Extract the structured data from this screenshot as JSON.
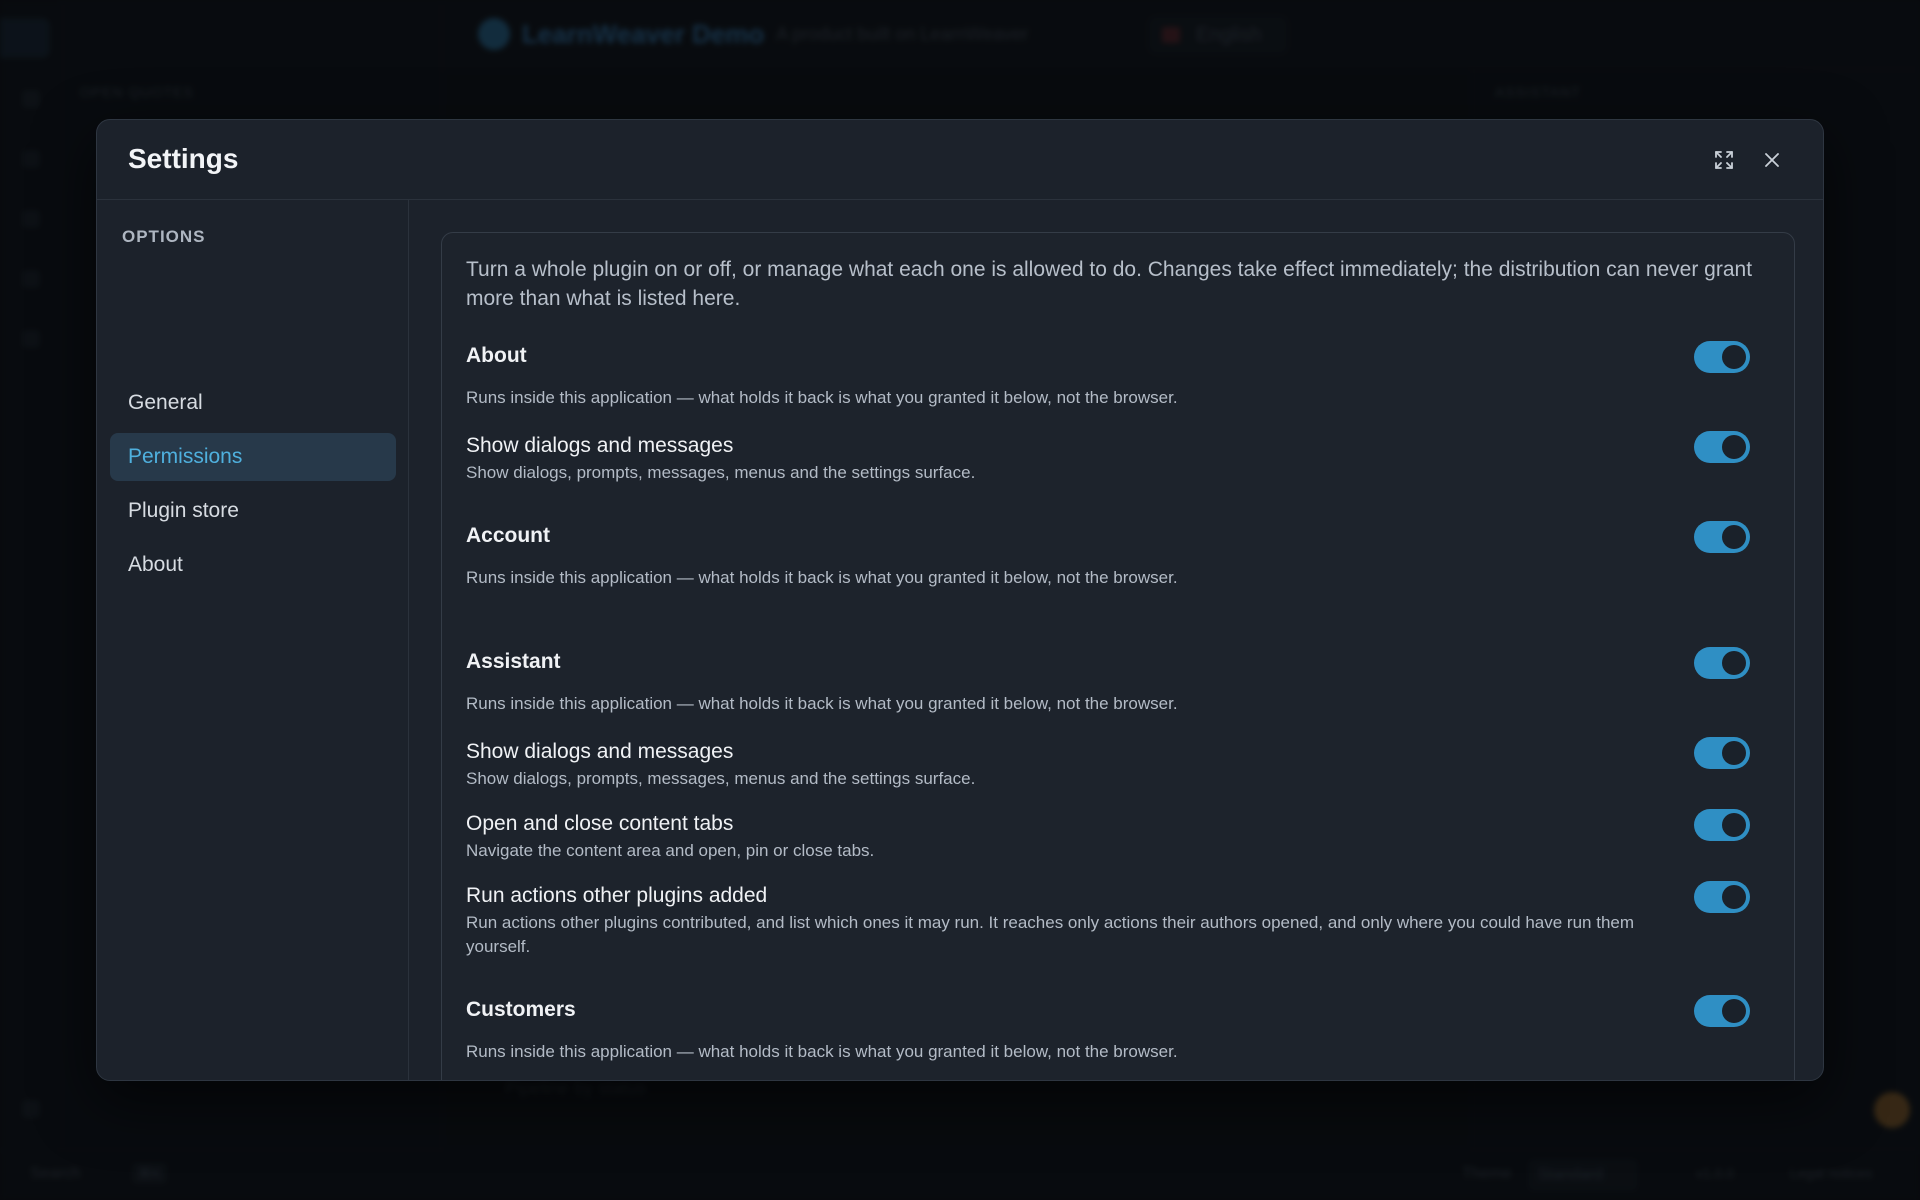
{
  "background": {
    "brand_name": "LearnWeaver Demo",
    "brand_tagline": "A product built on LearnWeaver",
    "language": "English",
    "left_section_title": "OPEN QUOTES",
    "right_section_title": "ASSISTANT",
    "pipeline_label": "Pipeline by status",
    "search_label": "Search",
    "search_shortcut": "⌘K",
    "theme_label": "Theme",
    "theme_value": "Standard",
    "version": "v1.0.0",
    "legal": "Legal notices"
  },
  "modal": {
    "title": "Settings",
    "expand_icon": "expand-icon",
    "close_icon": "close-icon"
  },
  "sidebar": {
    "section_label": "OPTIONS",
    "items": [
      {
        "label": "General",
        "active": false
      },
      {
        "label": "Permissions",
        "active": true
      },
      {
        "label": "Plugin store",
        "active": false
      },
      {
        "label": "About",
        "active": false
      }
    ]
  },
  "content": {
    "intro": "Turn a whole plugin on or off, or manage what each one is allowed to do. Changes take effect immediately; the distribution can never grant more than what is listed here.",
    "rows": [
      {
        "kind": "plugin",
        "title": "About",
        "desc": "Runs inside this application — what holds it back is what you granted it below, not the browser.",
        "enabled": true
      },
      {
        "kind": "permission",
        "title": "Show dialogs and messages",
        "desc": "Show dialogs, prompts, messages, menus and the settings surface.",
        "enabled": true
      },
      {
        "kind": "plugin",
        "title": "Account",
        "desc": "Runs inside this application — what holds it back is what you granted it below, not the browser.",
        "enabled": true
      },
      {
        "kind": "plugin",
        "title": "Assistant",
        "desc": "Runs inside this application — what holds it back is what you granted it below, not the browser.",
        "enabled": true
      },
      {
        "kind": "permission",
        "title": "Show dialogs and messages",
        "desc": "Show dialogs, prompts, messages, menus and the settings surface.",
        "enabled": true
      },
      {
        "kind": "permission",
        "title": "Open and close content tabs",
        "desc": "Navigate the content area and open, pin or close tabs.",
        "enabled": true
      },
      {
        "kind": "permission",
        "title": "Run actions other plugins added",
        "desc": "Run actions other plugins contributed, and list which ones it may run. It reaches only actions their authors opened, and only where you could have run them yourself.",
        "enabled": true
      },
      {
        "kind": "plugin",
        "title": "Customers",
        "desc": "Runs inside this application — what holds it back is what you granted it below, not the browser.",
        "enabled": true
      }
    ]
  },
  "colors": {
    "accent": "#2f8fc4",
    "active_nav_text": "#4fb0de",
    "modal_bg": "#1c222b"
  }
}
